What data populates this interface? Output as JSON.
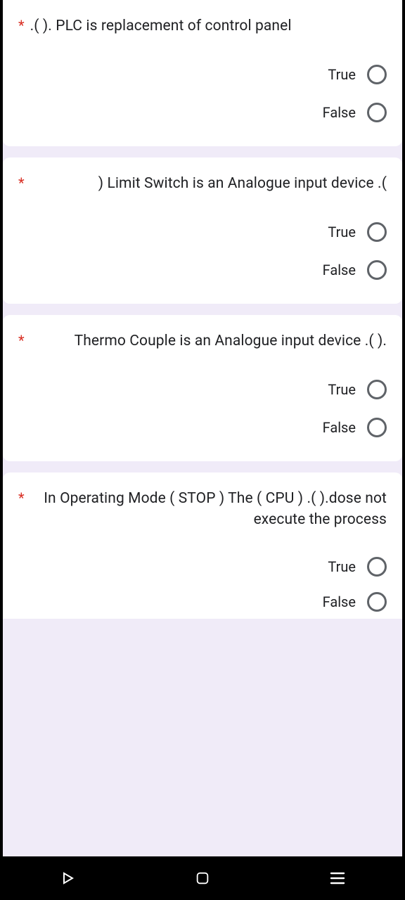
{
  "options": {
    "true": "True",
    "false": "False"
  },
  "questions": [
    {
      "text": ".(      ). PLC is replacement of control panel"
    },
    {
      "text": ") Limit Switch is an Analogue input device .("
    },
    {
      "text": "Thermo Couple is an Analogue input device .(     )."
    },
    {
      "text": "In Operating Mode ( STOP ) The  ( CPU ) .(     ).dose not execute the process"
    }
  ]
}
